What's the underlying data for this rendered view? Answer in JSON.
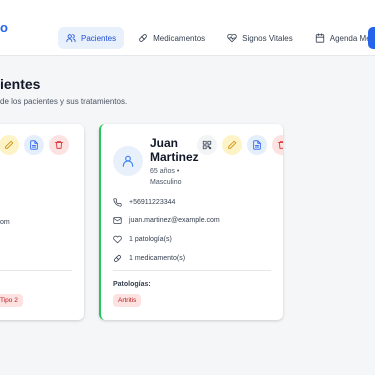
{
  "header": {
    "brand_fragment": "o",
    "nav": [
      {
        "label": "Pacientes",
        "icon": "users-icon",
        "active": true
      },
      {
        "label": "Medicamentos",
        "icon": "pill-icon",
        "active": false
      },
      {
        "label": "Signos Vitales",
        "icon": "heart-pulse-icon",
        "active": false
      },
      {
        "label": "Agenda Médica",
        "icon": "calendar-icon",
        "active": false
      }
    ],
    "accent_color": "#2563eb"
  },
  "page": {
    "title": "ientes",
    "subtitle": "de los pacientes y sus tratamientos."
  },
  "patients": [
    {
      "email_fragment": "om",
      "tag_fragment": "Tipo 2"
    },
    {
      "name": "Juan Martinez",
      "meta": "65 años • Masculino",
      "phone": "+56911223344",
      "email": "juan.martinez@example.com",
      "pathologies_count": "1 patología(s)",
      "medications_count": "1 medicamento(s)",
      "pathologies_label": "Patologías:",
      "pathologies": [
        "Artritis"
      ],
      "status_color": "#22c55e"
    }
  ]
}
